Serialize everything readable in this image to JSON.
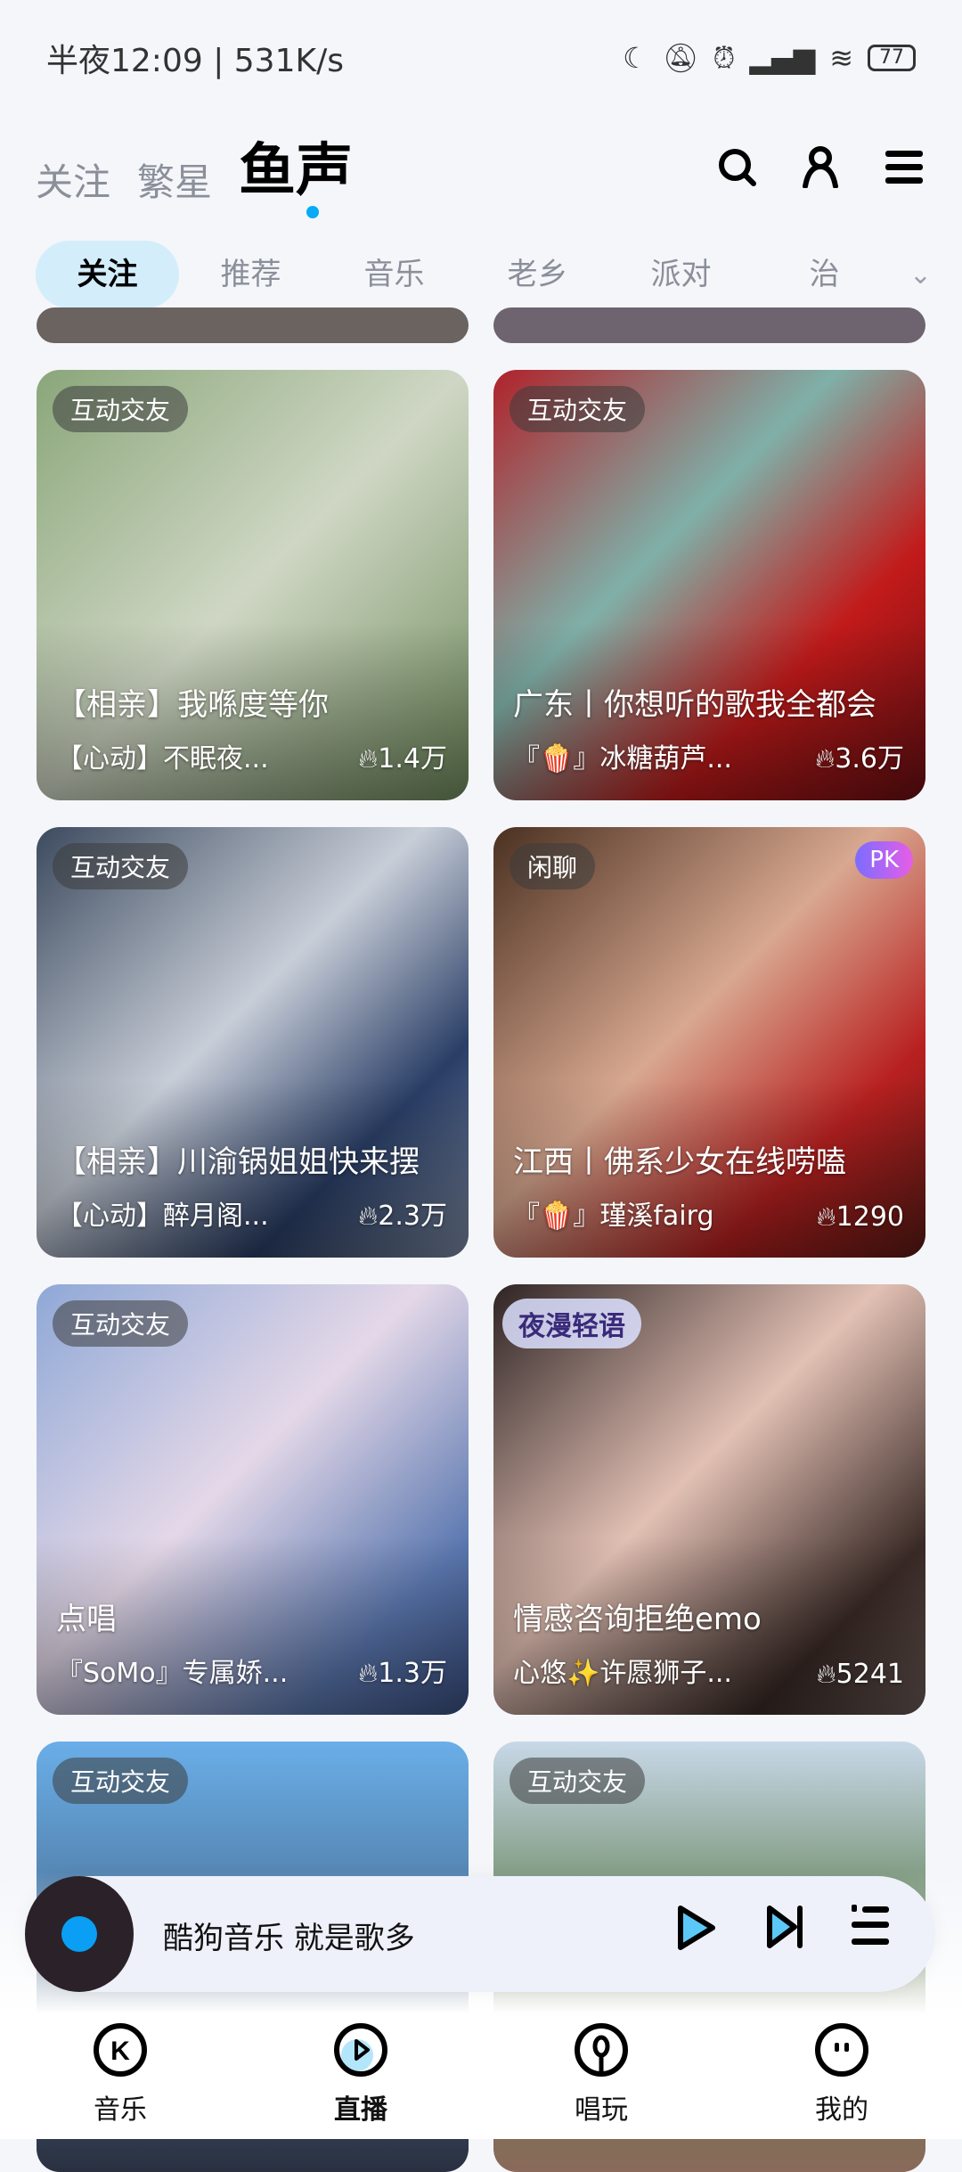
{
  "status": {
    "time": "半夜12:09",
    "speed": "531K/s",
    "battery": "77"
  },
  "top_tabs": [
    {
      "label": "关注"
    },
    {
      "label": "繁星"
    },
    {
      "label": "鱼声"
    }
  ],
  "chips": [
    {
      "label": "关注"
    },
    {
      "label": "推荐"
    },
    {
      "label": "音乐"
    },
    {
      "label": "老乡"
    },
    {
      "label": "派对"
    },
    {
      "label": "治"
    }
  ],
  "cards": [
    {
      "tag": "互动交友",
      "title": "【相亲】我喺度等你",
      "sub": "【心动】不眠夜...",
      "heat": "1.4万"
    },
    {
      "tag": "互动交友",
      "title": "广东丨你想听的歌我全都会",
      "sub": "『🍿』冰糖葫芦...",
      "heat": "3.6万"
    },
    {
      "tag": "互动交友",
      "title": "【相亲】川渝锅姐姐快来摆",
      "sub": "【心动】醉月阁...",
      "heat": "2.3万"
    },
    {
      "tag": "闲聊",
      "badge": "PK",
      "title": "江西丨佛系少女在线唠嗑",
      "sub": "『🍿』瑾溪fairg",
      "heat": "1290"
    },
    {
      "tag": "互动交友",
      "title": "点唱",
      "sub": "『SoMo』专属娇...",
      "heat": "1.3万"
    },
    {
      "badge": "夜漫轻语",
      "title": "情感咨询拒绝emo",
      "sub": "心悠✨许愿狮子...",
      "heat": "5241"
    },
    {
      "tag": "互动交友"
    },
    {
      "tag": "互动交友"
    }
  ],
  "player": {
    "text": "酷狗音乐  就是歌多"
  },
  "nav": [
    {
      "label": "音乐"
    },
    {
      "label": "直播"
    },
    {
      "label": "唱玩"
    },
    {
      "label": "我的"
    }
  ]
}
